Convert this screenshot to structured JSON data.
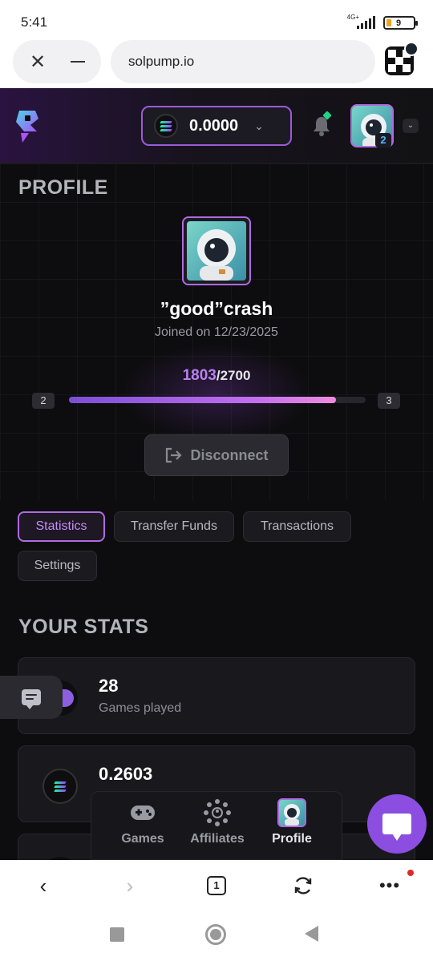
{
  "status_bar": {
    "time": "5:41",
    "network": "4G+",
    "battery": "9"
  },
  "browser": {
    "url": "solpump.io",
    "tab_count": "1"
  },
  "header": {
    "balance": "0.0000",
    "user_level": "2"
  },
  "profile": {
    "section_title": "PROFILE",
    "username": "”good”crash",
    "joined": "Joined on 12/23/2025",
    "xp_current": "1803",
    "xp_max": "/2700",
    "level_current": "2",
    "level_next": "3",
    "xp_progress": 0.9,
    "disconnect_label": "Disconnect"
  },
  "tabs": [
    {
      "label": "Statistics",
      "active": true
    },
    {
      "label": "Transfer Funds",
      "active": false
    },
    {
      "label": "Transactions",
      "active": false
    },
    {
      "label": "Settings",
      "active": false
    }
  ],
  "stats": {
    "section_title": "YOUR STATS",
    "cards": [
      {
        "value": "28",
        "label": "Games played",
        "icon": "gamepad-icon"
      },
      {
        "value": "0.2603",
        "label": "",
        "icon": "solana-icon"
      },
      {
        "value": "",
        "label": "",
        "icon": "coin-icon"
      }
    ]
  },
  "bottom_nav": [
    {
      "label": "Games",
      "icon": "gamepad-icon"
    },
    {
      "label": "Affiliates",
      "icon": "affiliates-network-icon"
    },
    {
      "label": "Profile",
      "icon": "avatar"
    }
  ],
  "colors": {
    "accent": "#b06ae0",
    "background": "#0d0d0f",
    "card": "#19191d",
    "success": "#1fd286"
  }
}
